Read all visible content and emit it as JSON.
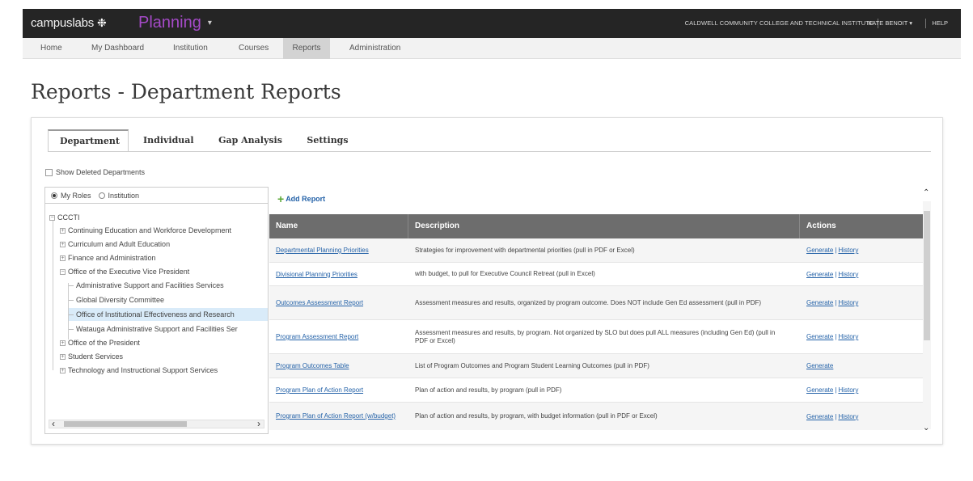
{
  "topbar": {
    "brand": "campuslabs",
    "brand_icon": "snowflake-logo-icon",
    "product": "Planning",
    "institution": "CALDWELL COMMUNITY COLLEGE AND TECHNICAL INSTITUTE",
    "user": "KATE BENOIT",
    "help": "HELP"
  },
  "nav": {
    "items": [
      "Home",
      "My Dashboard",
      "Institution",
      "Courses",
      "Reports",
      "Administration"
    ],
    "active": "Reports"
  },
  "page": {
    "title": "Reports - Department Reports"
  },
  "tabs": [
    "Department",
    "Individual",
    "Gap Analysis",
    "Settings"
  ],
  "show_deleted_label": "Show Deleted Departments",
  "tree": {
    "radio_my_roles": "My Roles",
    "radio_institution": "Institution",
    "root": "CCCTI",
    "items": [
      "Continuing Education and Workforce Development",
      "Curriculum and Adult Education",
      "Finance and Administration",
      "Office of the Executive Vice President",
      "Administrative Support and Facilities Services",
      "Global Diversity Committee",
      "Office of Institutional Effectiveness and Research",
      "Watauga Administrative Support and Facilities Ser",
      "Office of the President",
      "Student Services",
      "Technology and Instructional Support Services"
    ]
  },
  "reports": {
    "add_label": "Add Report",
    "headers": {
      "name": "Name",
      "description": "Description",
      "actions": "Actions"
    },
    "generate": "Generate",
    "history": "History",
    "rows": [
      {
        "name": "Departmental Planning Priorities",
        "desc": "Strategies for improvement with departmental priorities (pull in PDF or Excel)"
      },
      {
        "name": "Divisional Planning Priorities",
        "desc": "with budget, to pull for Executive Council Retreat (pull in Excel)"
      },
      {
        "name": "Outcomes Assessment Report",
        "desc": "Assessment measures and results, organized by program outcome. Does NOT include Gen Ed assessment (pull in PDF)"
      },
      {
        "name": "Program Assessment Report",
        "desc": "Assessment measures and results, by program. Not organized by SLO but does pull ALL measures (including Gen Ed) (pull in PDF or Excel)"
      },
      {
        "name": "Program Outcomes Table",
        "desc": "List of Program Outcomes and Program Student Learning Outcomes (pull in PDF)"
      },
      {
        "name": "Program Plan of Action Report",
        "desc": "Plan of action and results, by program (pull in PDF)"
      },
      {
        "name": "Program Plan of Action Report (w/budget)",
        "desc": "Plan of action and results, by program, with budget information (pull in PDF or Excel)"
      }
    ]
  },
  "colors": {
    "topbar": "#252525",
    "product": "#a54ac8",
    "link": "#2462a8",
    "table_header": "#6d6d6d",
    "selected": "#d9ebf9"
  }
}
